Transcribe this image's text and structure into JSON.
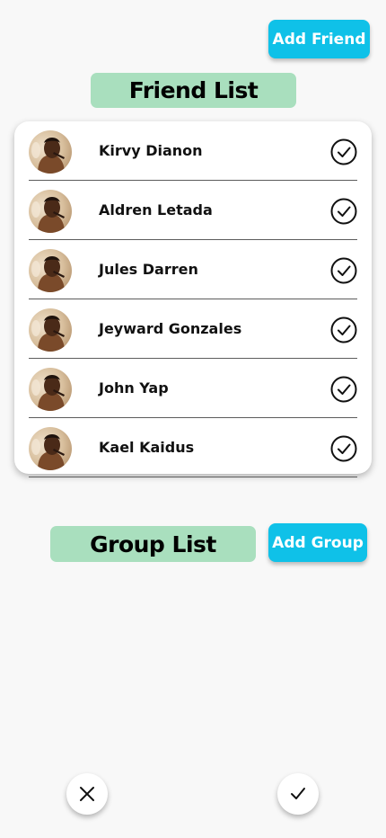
{
  "header": {
    "add_friend_label": "Add Friend"
  },
  "friend_list": {
    "title": "Friend List",
    "friends": [
      {
        "name": "Kirvy Dianon"
      },
      {
        "name": "Aldren Letada"
      },
      {
        "name": "Jules Darren"
      },
      {
        "name": "Jeyward Gonzales"
      },
      {
        "name": "John Yap"
      },
      {
        "name": "Kael Kaidus"
      }
    ]
  },
  "group_list": {
    "title": "Group List",
    "add_group_label": "Add Group"
  },
  "footer": {
    "cancel_icon": "close-icon",
    "confirm_icon": "check-icon"
  },
  "colors": {
    "accent": "#0fc1e8",
    "title_bg": "#a9dfbe",
    "background": "#f8f8f8"
  }
}
